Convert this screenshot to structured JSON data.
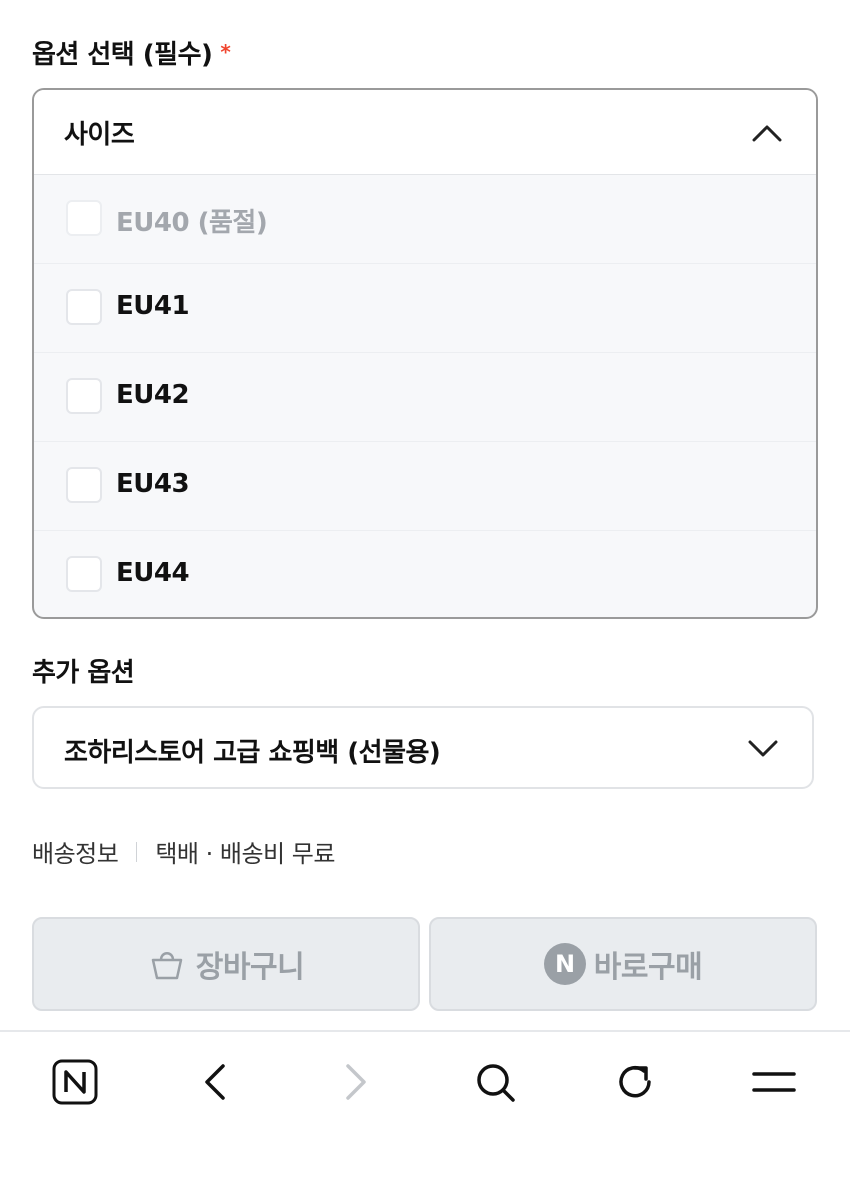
{
  "options_section": {
    "title": "옵션 선택 (필수)",
    "required_mark": "*"
  },
  "size_dropdown": {
    "label": "사이즈",
    "expanded": true,
    "items": [
      {
        "label": "EU40 (품절)",
        "disabled": true,
        "checked": false
      },
      {
        "label": "EU41",
        "disabled": false,
        "checked": false
      },
      {
        "label": "EU42",
        "disabled": false,
        "checked": false
      },
      {
        "label": "EU43",
        "disabled": false,
        "checked": false
      },
      {
        "label": "EU44",
        "disabled": false,
        "checked": false
      }
    ]
  },
  "extra_section": {
    "title": "추가 옵션",
    "selected_value": "조하리스토어 고급 쇼핑백 (선물용)"
  },
  "delivery": {
    "label": "배송정보",
    "value": "택배 · 배송비 무료"
  },
  "buttons": {
    "cart_label": "장바구니",
    "buy_label": "바로구매",
    "npay_badge": "N"
  },
  "toolbar": {
    "home_icon_letter": "N"
  },
  "colors": {
    "required": "#f0452f",
    "disabled_text": "#9aa0a6",
    "button_bg": "#e9ecef"
  }
}
